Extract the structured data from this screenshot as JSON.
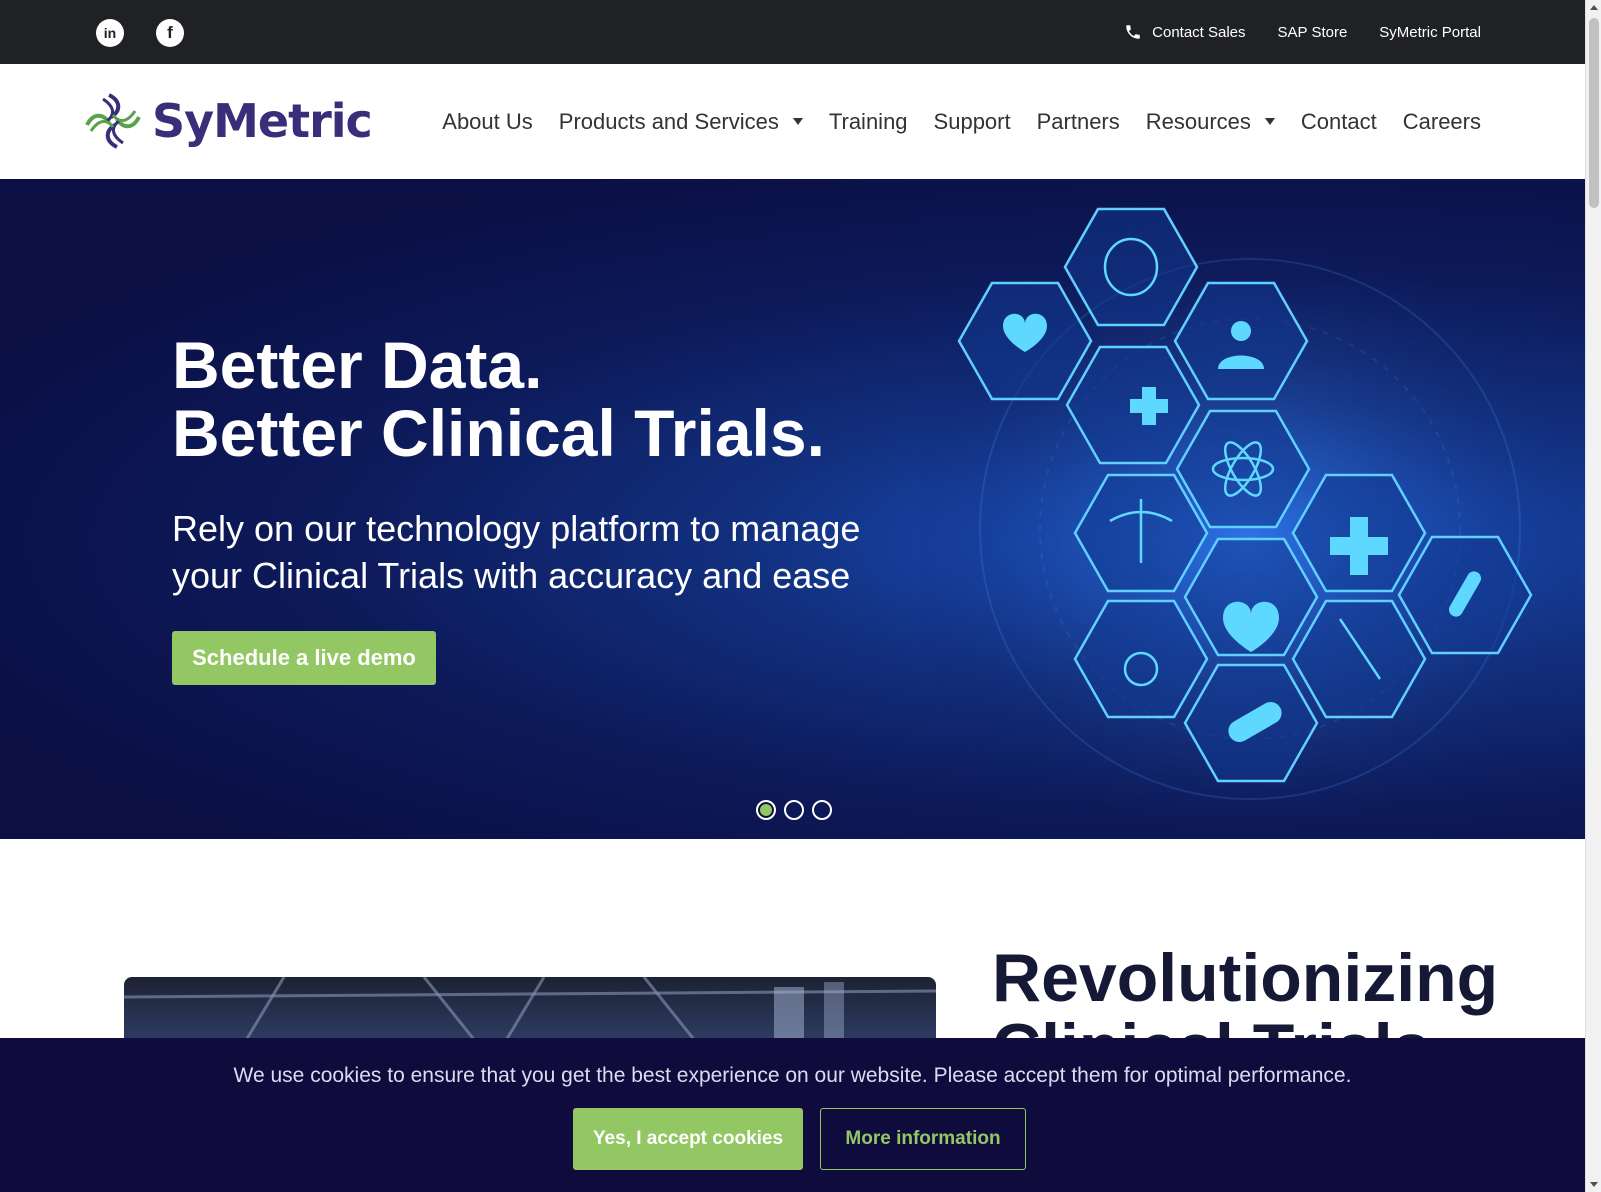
{
  "topbar": {
    "social": {
      "linkedin_glyph": "in",
      "facebook_glyph": "f"
    },
    "links": [
      {
        "label": "Contact Sales",
        "icon": "phone-icon"
      },
      {
        "label": "SAP Store"
      },
      {
        "label": "SyMetric Portal"
      }
    ]
  },
  "header": {
    "logo_text": "SyMetric",
    "nav": [
      {
        "label": "About Us"
      },
      {
        "label": "Products and Services",
        "dropdown": true
      },
      {
        "label": "Training"
      },
      {
        "label": "Support"
      },
      {
        "label": "Partners"
      },
      {
        "label": "Resources",
        "dropdown": true
      },
      {
        "label": "Contact"
      },
      {
        "label": "Careers"
      }
    ]
  },
  "hero": {
    "title_line1": "Better Data.",
    "title_line2": "Better Clinical Trials.",
    "subtitle_line1": "Rely on our technology platform to manage",
    "subtitle_line2": "your Clinical Trials with accuracy and ease",
    "cta_label": "Schedule a live demo",
    "slides": 3,
    "active_slide": 1
  },
  "section": {
    "title_line1": "Revolutionizing",
    "title_line2": "Clinical Trials"
  },
  "cookie": {
    "message": "We use cookies to ensure that you get the best experience on our website. Please accept them for optimal performance.",
    "accept_label": "Yes, I accept cookies",
    "more_label": "More information"
  },
  "colors": {
    "brand_purple": "#3b2d7a",
    "accent_green": "#93c763",
    "topbar_bg": "#202124",
    "hero_bg": "#0b0f44",
    "cookie_bg": "#0f0b3d"
  }
}
